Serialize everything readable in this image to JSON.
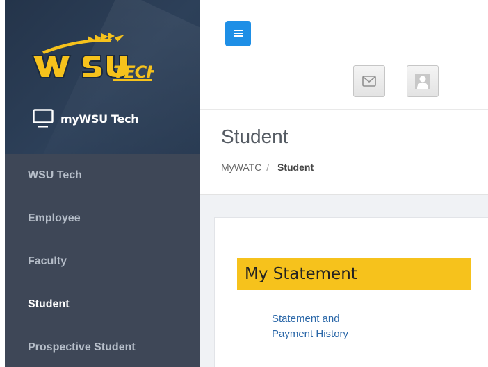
{
  "colors": {
    "sidebar_bg": "#3e4757",
    "sidebar_header_bg": "#2d4059",
    "accent_blue": "#1e8fe6",
    "brand_gold": "#f6c21c",
    "link_blue": "#2a67a8"
  },
  "sidebar": {
    "logo_text": "WSU TECH",
    "app_name": "myWSU Tech",
    "app_icon": "monitor-icon",
    "items": [
      {
        "label": "WSU Tech",
        "active": false
      },
      {
        "label": "Employee",
        "active": false
      },
      {
        "label": "Faculty",
        "active": false
      },
      {
        "label": "Student",
        "active": true
      },
      {
        "label": "Prospective Student",
        "active": false
      }
    ]
  },
  "header": {
    "menu_icon": "hamburger-icon",
    "mail_icon": "envelope-icon",
    "profile_icon": "user-silhouette-icon"
  },
  "page": {
    "title": "Student",
    "breadcrumb": {
      "root": "MyWATC",
      "separator": "/",
      "current": "Student"
    }
  },
  "content": {
    "section_title": "My Statement",
    "links": [
      {
        "label": "Statement and\nPayment History"
      }
    ]
  }
}
